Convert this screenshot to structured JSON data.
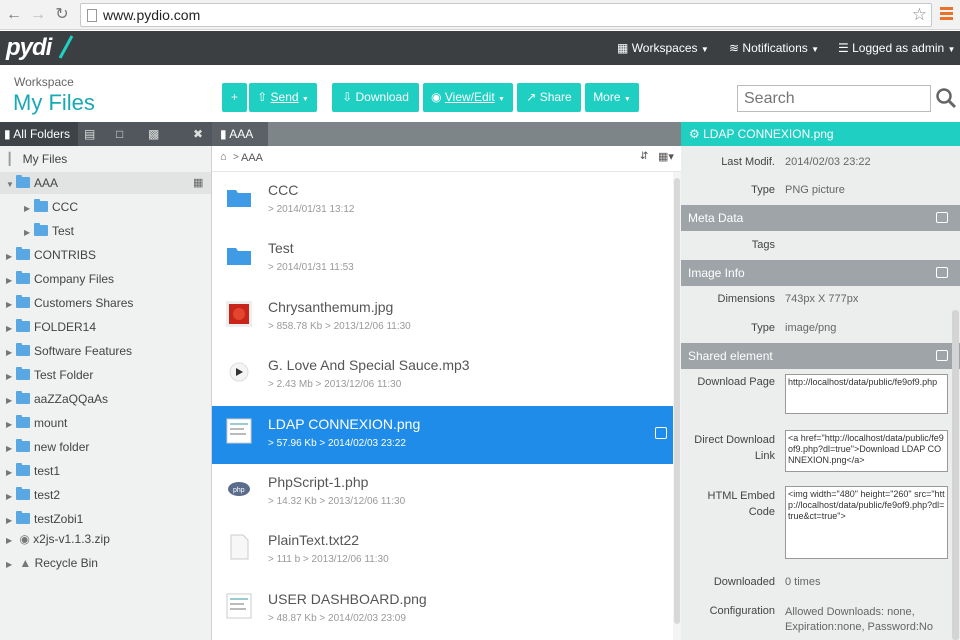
{
  "browser": {
    "url": "www.pydio.com"
  },
  "app": {
    "logo": "pydi",
    "menu": {
      "workspaces": "Workspaces",
      "notifications": "Notifications",
      "user": "Logged as admin"
    }
  },
  "workspace": {
    "label": "Workspace",
    "title": "My Files"
  },
  "toolbar": {
    "add": "+",
    "send": "Send",
    "download": "Download",
    "view_edit": "View/Edit",
    "share": "Share",
    "more": "More",
    "search_placeholder": "Search"
  },
  "left_panel": {
    "tab_all_folders": "All Folders",
    "root": "My Files",
    "tree": [
      {
        "label": "AAA",
        "level": 1
      },
      {
        "label": "CCC",
        "level": 2
      },
      {
        "label": "Test",
        "level": 2
      },
      {
        "label": "CONTRIBS",
        "level": 1
      },
      {
        "label": "Company Files",
        "level": 1
      },
      {
        "label": "Customers Shares",
        "level": 1
      },
      {
        "label": "FOLDER14",
        "level": 1
      },
      {
        "label": "Software Features",
        "level": 1
      },
      {
        "label": "Test Folder",
        "level": 1
      },
      {
        "label": "aaZZaQQaAs",
        "level": 1
      },
      {
        "label": "mount",
        "level": 1
      },
      {
        "label": "new folder",
        "level": 1
      },
      {
        "label": "test1",
        "level": 1
      },
      {
        "label": "test2",
        "level": 1
      },
      {
        "label": "testZobi1",
        "level": 1
      }
    ],
    "zip": "x2js-v1.1.3.zip",
    "recycle": "Recycle Bin"
  },
  "center": {
    "tab": "AAA",
    "breadcrumb": "AAA",
    "files": [
      {
        "name": "CCC",
        "meta": "> 2014/01/31 13:12",
        "kind": "folder"
      },
      {
        "name": "Test",
        "meta": "> 2014/01/31 11:53",
        "kind": "folder"
      },
      {
        "name": "Chrysanthemum.jpg",
        "meta": "> 858.78 Kb > 2013/12/06 11:30",
        "kind": "image"
      },
      {
        "name": "G. Love And Special Sauce.mp3",
        "meta": "> 2.43 Mb > 2013/12/06 11:30",
        "kind": "audio"
      },
      {
        "name": "LDAP CONNEXION.png",
        "meta": "> 57.96 Kb > 2014/02/03 23:22",
        "kind": "png",
        "selected": true
      },
      {
        "name": "PhpScript-1.php",
        "meta": "> 14.32 Kb > 2013/12/06 11:30",
        "kind": "php"
      },
      {
        "name": "PlainText.txt22",
        "meta": "> 111 b > 2013/12/06 11:30",
        "kind": "text"
      },
      {
        "name": "USER DASHBOARD.png",
        "meta": "> 48.87 Kb > 2014/02/03 23:09",
        "kind": "png"
      }
    ]
  },
  "details": {
    "title": "LDAP CONNEXION.png",
    "last_modif_label": "Last Modif.",
    "last_modif": "2014/02/03 23:22",
    "type_label": "Type",
    "type": "PNG picture",
    "meta_section": "Meta Data",
    "tags_label": "Tags",
    "image_section": "Image Info",
    "dimensions_label": "Dimensions",
    "dimensions": "743px X 777px",
    "img_type_label": "Type",
    "img_type": "image/png",
    "shared_section": "Shared element",
    "download_page_label": "Download Page",
    "download_page": "http://localhost/data/public/fe9of9.php",
    "direct_link_label": "Direct Download Link",
    "direct_link": "<a href=\"http://localhost/data/public/fe9of9.php?dl=true\">Download LDAP CONNEXION.png</a>",
    "embed_label": "HTML Embed Code",
    "embed": "<img width=\"480\" height=\"260\" src=\"http://localhost/data/public/fe9of9.php?dl=true&ct=true\">",
    "downloaded_label": "Downloaded",
    "downloaded": "0 times",
    "config_label": "Configuration",
    "config": "Allowed Downloads: none, Expiration:none, Password:No"
  },
  "colors": {
    "accent": "#1fcfc2",
    "selection": "#1e8ce8",
    "topbar": "#3b3f42"
  }
}
